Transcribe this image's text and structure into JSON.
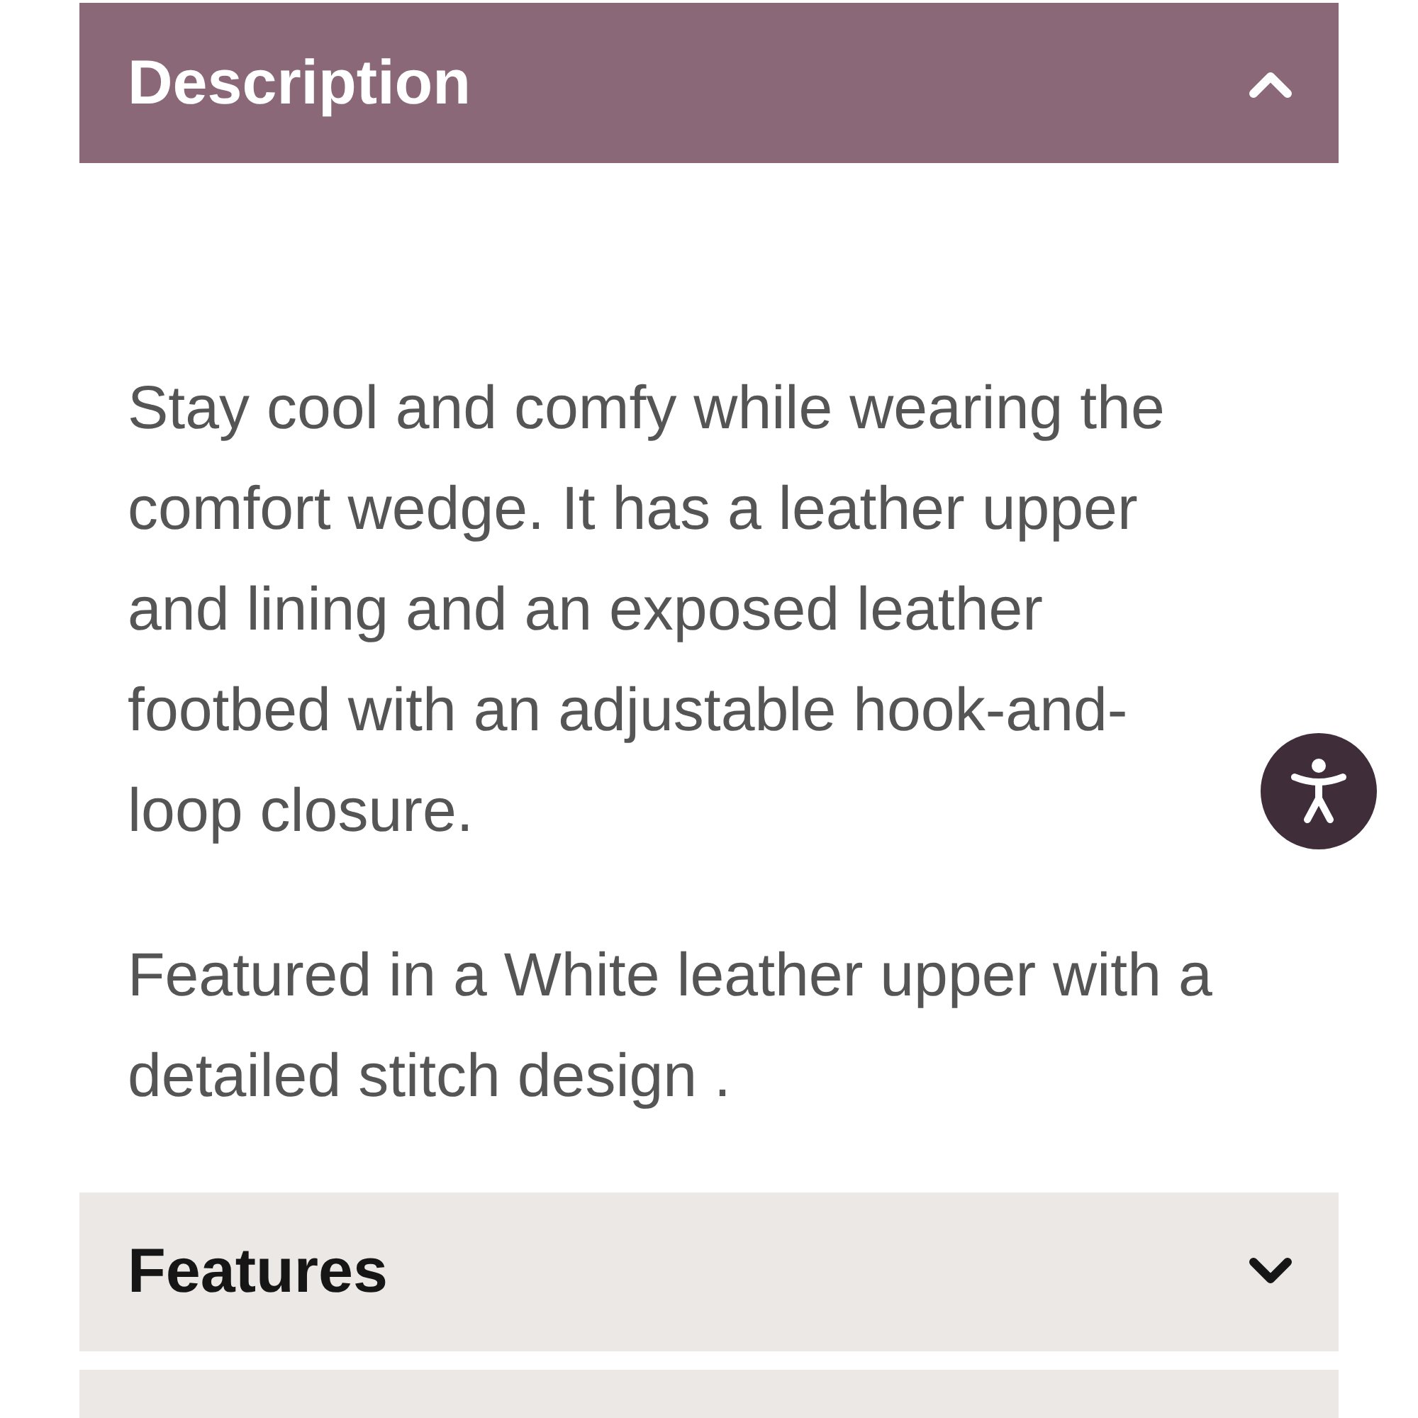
{
  "accordion": [
    {
      "title": "Description",
      "expanded": true,
      "paragraphs": [
        "Stay cool and comfy while wearing the comfort wedge. It has a leather upper and lining and an exposed leather footbed with an adjustable hook-and-loop closure.",
        "Featured in a White leather upper with a detailed stitch design ."
      ]
    },
    {
      "title": "Features",
      "expanded": false
    },
    {
      "expanded": false
    }
  ]
}
